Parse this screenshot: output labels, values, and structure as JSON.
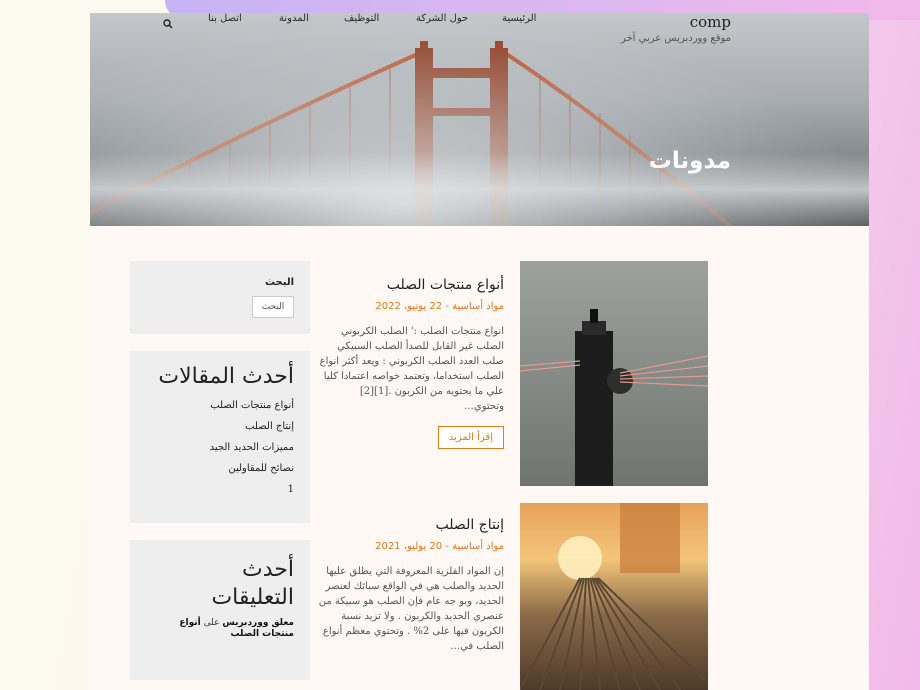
{
  "site": {
    "name": "comp",
    "tagline": "موقع ووردبريس عربي آخر"
  },
  "nav": {
    "items": [
      "الرئيسية",
      "حول الشركة",
      "التوظيف",
      "المدونة",
      "اتصل بنا"
    ],
    "search_icon": "search-icon"
  },
  "hero": {
    "title": "مدونات"
  },
  "posts": [
    {
      "title": "أنواع منتجات الصلب",
      "category": "مواد أساسية",
      "date": "22 يونيو، 2022",
      "excerpt": "انواع منتجات الصلب :' الصلب الكربوني الصلب غير القابل للصدأ الصلب السبيكي صلب العدد الصلب الكربوني : ويعد أكثر انواع الصلب استخداما، وتعتمد خواصه اعتمادا كليا علي ما يحتويه من الكربون .[1][2] وتحتوي…",
      "read_more": "إقرأ المزيد"
    },
    {
      "title": "إنتاج الصلب",
      "category": "مواد أساسية",
      "date": "20 يوليو، 2021",
      "excerpt": "إن المواد الفلزية المعروفة التي يطلق عليها الحديد والصلب هي في الواقع سبائك لعنصر الحديد، وبو جه عام فإن الصلب هو سبيكة من عنصري الحديد والكربون . ولا تزيد نسبة الكربون فيها على 2% . وتحتوي معظم أنواع الصلب في…"
    }
  ],
  "sidebar": {
    "search": {
      "label": "البحث",
      "button": "البحث"
    },
    "recent_posts": {
      "title": "أحدث المقالات",
      "items": [
        "أنواع منتجات الصلب",
        "إنتاج الصلب",
        "مميزات الحديد الجيد",
        "نصائح للمقاولين",
        "1"
      ]
    },
    "recent_comments": {
      "title": "أحدث التعليقات",
      "author": "معلق ووردبريس",
      "on": "على",
      "post": "أنواع منتجات الصلب"
    }
  },
  "colors": {
    "accent": "#e07a1f",
    "widget_bg": "#eeeeee"
  }
}
